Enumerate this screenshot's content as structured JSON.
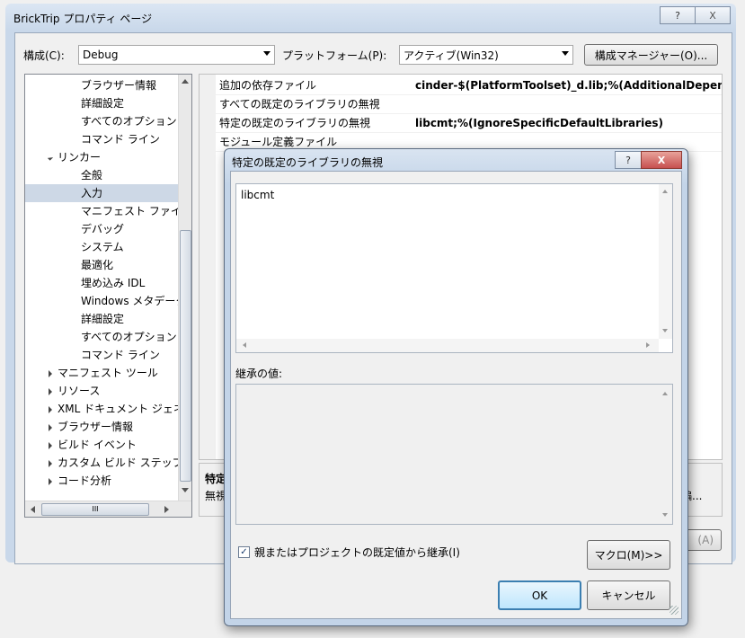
{
  "window": {
    "title": "BrickTrip プロパティ ページ",
    "help_btn": "?",
    "close_btn": "X"
  },
  "config": {
    "config_label": "構成(C):",
    "config_value": "Debug",
    "platform_label": "プラットフォーム(P):",
    "platform_value": "アクティブ(Win32)",
    "manager_button": "構成マネージャー(O)..."
  },
  "tree": {
    "items": [
      {
        "label": "ブラウザー情報",
        "indent": 2,
        "toggle": "none"
      },
      {
        "label": "詳細設定",
        "indent": 2,
        "toggle": "none"
      },
      {
        "label": "すべてのオプション",
        "indent": 2,
        "toggle": "none"
      },
      {
        "label": "コマンド ライン",
        "indent": 2,
        "toggle": "none"
      },
      {
        "label": "リンカー",
        "indent": 1,
        "toggle": "open"
      },
      {
        "label": "全般",
        "indent": 2,
        "toggle": "none"
      },
      {
        "label": "入力",
        "indent": 2,
        "toggle": "none",
        "selected": true
      },
      {
        "label": "マニフェスト ファイル",
        "indent": 2,
        "toggle": "none"
      },
      {
        "label": "デバッグ",
        "indent": 2,
        "toggle": "none"
      },
      {
        "label": "システム",
        "indent": 2,
        "toggle": "none"
      },
      {
        "label": "最適化",
        "indent": 2,
        "toggle": "none"
      },
      {
        "label": "埋め込み IDL",
        "indent": 2,
        "toggle": "none"
      },
      {
        "label": "Windows メタデータ",
        "indent": 2,
        "toggle": "none"
      },
      {
        "label": "詳細設定",
        "indent": 2,
        "toggle": "none"
      },
      {
        "label": "すべてのオプション",
        "indent": 2,
        "toggle": "none"
      },
      {
        "label": "コマンド ライン",
        "indent": 2,
        "toggle": "none"
      },
      {
        "label": "マニフェスト ツール",
        "indent": 1,
        "toggle": "closed"
      },
      {
        "label": "リソース",
        "indent": 1,
        "toggle": "closed"
      },
      {
        "label": "XML ドキュメント ジェネレーター",
        "indent": 1,
        "toggle": "closed"
      },
      {
        "label": "ブラウザー情報",
        "indent": 1,
        "toggle": "closed"
      },
      {
        "label": "ビルド イベント",
        "indent": 1,
        "toggle": "closed"
      },
      {
        "label": "カスタム ビルド ステップ",
        "indent": 1,
        "toggle": "closed"
      },
      {
        "label": "コード分析",
        "indent": 1,
        "toggle": "closed"
      }
    ],
    "hscroll_thumb": "III"
  },
  "props": {
    "rows": [
      {
        "key": "追加の依存ファイル",
        "value": "cinder-$(PlatformToolset)_d.lib;%(AdditionalDepen"
      },
      {
        "key": "すべての既定のライブラリの無視",
        "value": ""
      },
      {
        "key": "特定の既定のライブラリの無視",
        "value": "libcmt;%(IgnoreSpecificDefaultLibraries)"
      },
      {
        "key": "モジュール定義ファイル",
        "value": ""
      }
    ],
    "desc_title": "特定",
    "desc_text": "無視",
    "desc_edit": "編...",
    "apply_button": "(A)"
  },
  "dialog": {
    "title": "特定の既定のライブラリの無視",
    "help_btn": "?",
    "close_btn": "X",
    "edit_value": "libcmt",
    "inherited_label": "継承の値:",
    "inherit_checkbox_label": "親またはプロジェクトの既定値から継承(I)",
    "inherit_checked": true,
    "macro_button": "マクロ(M)>>",
    "ok_button": "OK",
    "cancel_button": "キャンセル"
  },
  "colors": {
    "selection": "#cdd8e6",
    "title_bar": "#c9d8ea",
    "close_red": "#c75050"
  }
}
